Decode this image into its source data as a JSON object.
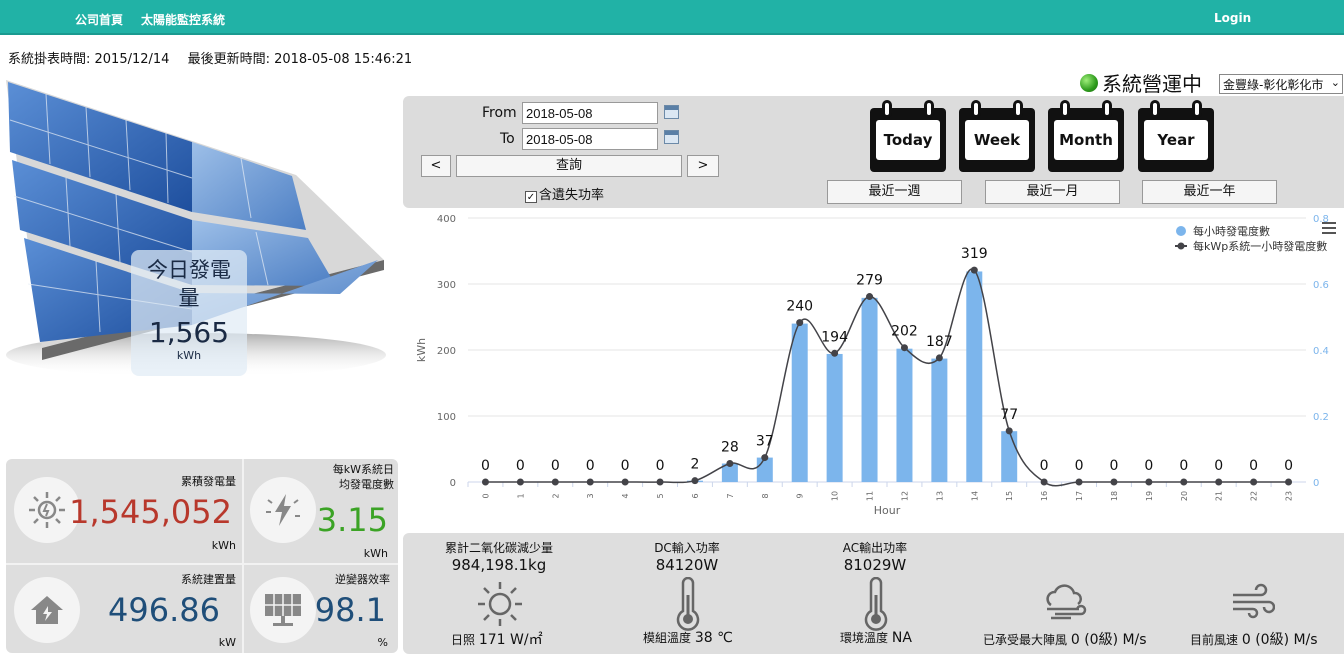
{
  "nav": {
    "home": "公司首頁",
    "monitor": "太陽能監控系統",
    "login": "Login"
  },
  "info": {
    "since": "系統掛表時間: 2015/12/14",
    "updated": "最後更新時間: 2018-05-08 15:46:21"
  },
  "today": {
    "title": "今日發電量",
    "value": "1,565",
    "unit": "kWh"
  },
  "stats": {
    "total": {
      "label": "累積發電量",
      "value": "1,545,052",
      "unit": "kWh",
      "color": "#b8382c"
    },
    "per_kw": {
      "label1": "每kW系統日",
      "label2": "均發電度數",
      "value": "3.15",
      "unit": "kWh",
      "color": "#3ba325"
    },
    "capacity": {
      "label": "系統建置量",
      "value": "496.86",
      "unit": "kW",
      "color": "#1f4e79"
    },
    "inverter": {
      "label": "逆變器效率",
      "value": "98.1",
      "unit": "%",
      "color": "#1f4e79"
    }
  },
  "status": {
    "text": "系統營運中",
    "site": "金豐綠-彰化彰化市"
  },
  "query": {
    "from_label": "From",
    "to_label": "To",
    "from": "2018-05-08",
    "to": "2018-05-08",
    "prev": "<",
    "next": ">",
    "search": "查詢",
    "checkbox": "含遺失功率",
    "today": "Today",
    "week": "Week",
    "month": "Month",
    "year": "Year",
    "last_week": "最近一週",
    "last_month": "最近一月",
    "last_year": "最近一年"
  },
  "chart_data": {
    "type": "bar",
    "xlabel": "Hour",
    "ylabel": "kWh",
    "ylim": [
      0,
      400
    ],
    "yticks": [
      0,
      100,
      200,
      300,
      400
    ],
    "y2ticks": [
      "0",
      "0.2",
      "0.4",
      "0.6",
      "0.8"
    ],
    "y2lim": [
      0,
      0.8
    ],
    "categories": [
      "0",
      "1",
      "2",
      "3",
      "4",
      "5",
      "6",
      "7",
      "8",
      "9",
      "10",
      "11",
      "12",
      "13",
      "14",
      "15",
      "16",
      "17",
      "18",
      "19",
      "20",
      "21",
      "22",
      "23"
    ],
    "series": [
      {
        "name": "每小時發電度數",
        "type": "bar",
        "color": "#7cb5ec",
        "values": [
          0,
          0,
          0,
          0,
          0,
          0,
          2,
          28,
          37,
          240,
          194,
          279,
          202,
          187,
          319,
          77,
          0,
          0,
          0,
          0,
          0,
          0,
          0,
          0
        ]
      },
      {
        "name": "每kWp系統一小時發電度數",
        "type": "line",
        "color": "#434348",
        "values": [
          0,
          0,
          0,
          0,
          0,
          0,
          0.004,
          0.056,
          0.074,
          0.483,
          0.39,
          0.562,
          0.407,
          0.376,
          0.642,
          0.155,
          0,
          0,
          0,
          0,
          0,
          0,
          0,
          0
        ]
      }
    ],
    "legend": "top-right",
    "grid": true
  },
  "bottom": {
    "co2": {
      "label": "累計二氧化碳減少量",
      "value": "984,198.1kg"
    },
    "dc": {
      "label": "DC輸入功率",
      "value": "84120W"
    },
    "ac": {
      "label": "AC輸出功率",
      "value": "81029W"
    },
    "irradiance": {
      "label": "日照",
      "value": "171 W/㎡"
    },
    "module_temp": {
      "label": "模組溫度",
      "value": "38 ℃"
    },
    "ambient_temp": {
      "label": "環境溫度",
      "value": "NA"
    },
    "max_wind": {
      "label": "已承受最大陣風",
      "value": "0 (0級) M/s"
    },
    "wind": {
      "label": "目前風速",
      "value": "0 (0級) M/s"
    }
  }
}
